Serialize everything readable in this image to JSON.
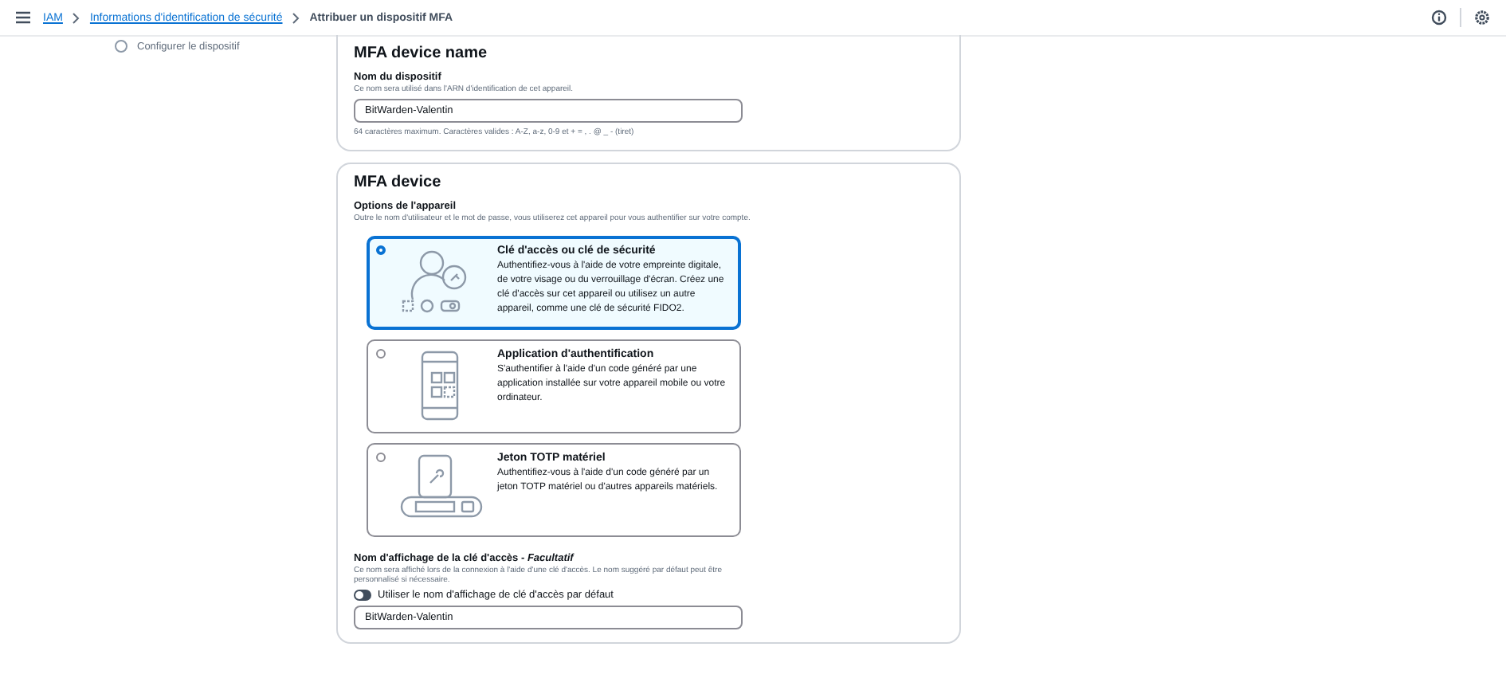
{
  "breadcrumbs": [
    {
      "label": "IAM",
      "kind": "link"
    },
    {
      "label": "Informations d'identification de sécurité",
      "kind": "link"
    },
    {
      "label": "Attribuer un dispositif MFA",
      "kind": "current"
    }
  ],
  "steps": [
    {
      "label": "Configurer le dispositif",
      "selected": false
    }
  ],
  "name_section": {
    "title": "MFA device name",
    "field_label": "Nom du dispositif",
    "field_description": "Ce nom sera utilisé dans l'ARN d'identification de cet appareil.",
    "value": "BitWarden-Valentin",
    "constraint": "64 caractères maximum. Caractères valides : A-Z, a-z, 0-9 et + = , . @ _ - (tiret)"
  },
  "device_section": {
    "title": "MFA device",
    "options_label": "Options de l'appareil",
    "options_description": "Outre le nom d'utilisateur et le mot de passe, vous utiliserez cet appareil pour vous authentifier sur votre compte.",
    "options": [
      {
        "kind": "passkey",
        "title": "Clé d'accès ou clé de sécurité",
        "description": "Authentifiez-vous à l'aide de votre empreinte digitale, de votre visage ou du verrouillage d'écran. Créez une clé d'accès sur cet appareil ou utilisez un autre appareil, comme une clé de sécurité FIDO2.",
        "selected": true
      },
      {
        "kind": "app",
        "title": "Application d'authentification",
        "description": "S'authentifier à l'aide d'un code généré par une application installée sur votre appareil mobile ou votre ordinateur.",
        "selected": false
      },
      {
        "kind": "token",
        "title": "Jeton TOTP matériel",
        "description": "Authentifiez-vous à l'aide d'un code généré par un jeton TOTP matériel ou d'autres appareils matériels.",
        "selected": false
      }
    ],
    "display_name_label": "Nom d'affichage de la clé d'accès - *Facultatif*",
    "display_name_description": "Ce nom sera affiché lors de la connexion à l'aide d'une clé d'accès. Le nom suggéré par défaut peut être personnalisé si nécessaire.",
    "toggle": {
      "label": "Utiliser le nom d'affichage de clé d'accès par défaut",
      "on": false
    },
    "display_name_value": "BitWarden-Valentin"
  }
}
